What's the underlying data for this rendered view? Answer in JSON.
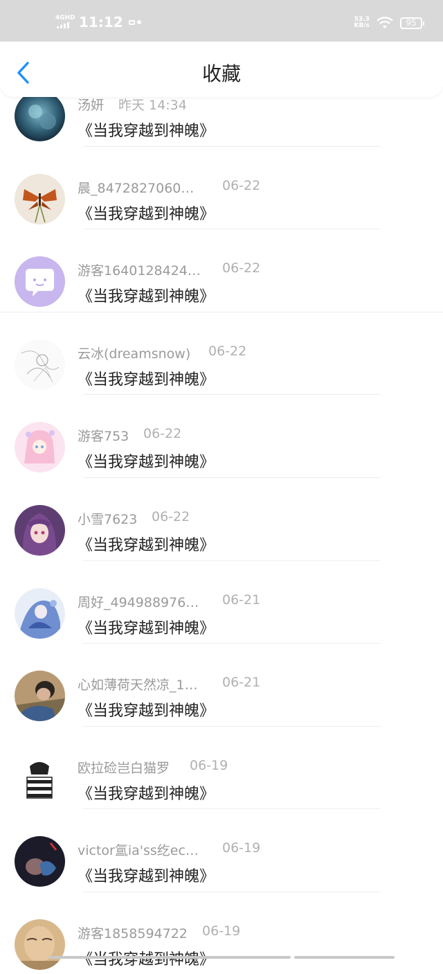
{
  "status_bar": {
    "network": "4GHD",
    "time": "11:12",
    "speed_value": "53.3",
    "speed_unit": "KB/s",
    "battery": "95"
  },
  "nav": {
    "title": "收藏",
    "back_icon": "chevron-left-icon",
    "accent": "#1e90ff"
  },
  "items": [
    {
      "name": "汤妍",
      "date": "昨天 14:34",
      "book": "《当我穿越到神魄》",
      "avatar": "avatar-dark-blue-art"
    },
    {
      "name": "晨_8472827060…",
      "date": "06-22",
      "book": "《当我穿越到神魄》",
      "avatar": "avatar-butterfly"
    },
    {
      "name": "游客1640128424…",
      "date": "06-22",
      "book": "《当我穿越到神魄》",
      "avatar": "avatar-default-chat"
    },
    {
      "name": "云冰(dreamsnow)",
      "date": "06-22",
      "book": "《当我穿越到神魄》",
      "avatar": "avatar-sketch"
    },
    {
      "name": "游客753",
      "date": "06-22",
      "book": "《当我穿越到神魄》",
      "avatar": "avatar-pink-anime"
    },
    {
      "name": "小雪7623",
      "date": "06-22",
      "book": "《当我穿越到神魄》",
      "avatar": "avatar-purple-anime"
    },
    {
      "name": "周好_494988976…",
      "date": "06-21",
      "book": "《当我穿越到神魄》",
      "avatar": "avatar-blue-anime"
    },
    {
      "name": "心如薄荷天然凉_1…",
      "date": "06-21",
      "book": "《当我穿越到神魄》",
      "avatar": "avatar-photo-boy"
    },
    {
      "name": "欧拉硷岂白猫罗",
      "date": "06-19",
      "book": "《当我穿越到神魄》",
      "avatar": "avatar-striped-sketch"
    },
    {
      "name": "victor氲ia'ss纥ec…",
      "date": "06-19",
      "book": "《当我穿越到神魄》",
      "avatar": "avatar-dark-photo"
    },
    {
      "name": "游客1858594722",
      "date": "06-19",
      "book": "《当我穿越到神魄》",
      "avatar": "avatar-face-photo"
    }
  ],
  "date_offsets_note_removed": true
}
